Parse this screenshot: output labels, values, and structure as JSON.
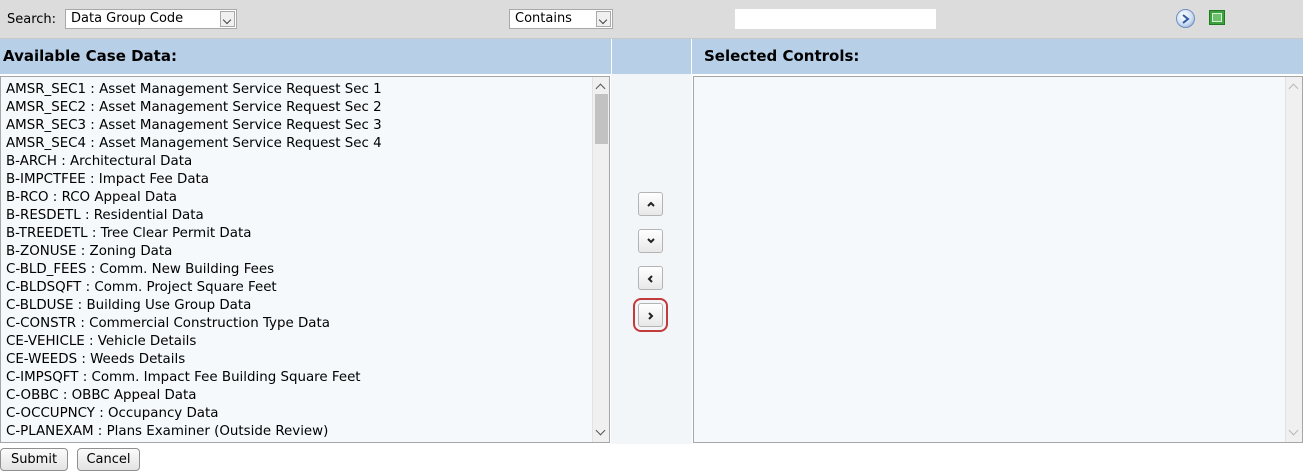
{
  "search": {
    "label": "Search:",
    "field_value": "Data Group Code",
    "operator_value": "Contains",
    "text_value": ""
  },
  "icons": {
    "go": "play-circle-icon",
    "toggle": "green-square-icon"
  },
  "headers": {
    "available": "Available Case Data:",
    "selected": "Selected Controls:"
  },
  "available_items": [
    "AMSR_SEC1 : Asset Management Service Request Sec 1",
    "AMSR_SEC2 : Asset Management Service Request Sec 2",
    "AMSR_SEC3 : Asset Management Service Request Sec 3",
    "AMSR_SEC4 : Asset Management Service Request Sec 4",
    "B-ARCH : Architectural Data",
    "B-IMPCTFEE : Impact Fee Data",
    "B-RCO : RCO Appeal Data",
    "B-RESDETL : Residential Data",
    "B-TREEDETL : Tree Clear Permit Data",
    "B-ZONUSE : Zoning Data",
    "C-BLD_FEES : Comm. New Building Fees",
    "C-BLDSQFT : Comm. Project Square Feet",
    "C-BLDUSE : Building Use Group Data",
    "C-CONSTR : Commercial Construction Type Data",
    "CE-VEHICLE : Vehicle Details",
    "CE-WEEDS : Weeds Details",
    "C-IMPSQFT : Comm. Impact Fee Building Square Feet",
    "C-OBBC : OBBC Appeal Data",
    "C-OCCUPNCY : Occupancy Data",
    "C-PLANEXAM : Plans Examiner (Outside Review)"
  ],
  "selected_items": [],
  "move_buttons": {
    "up": "chevron-up-icon",
    "down": "chevron-down-icon",
    "remove": "chevron-left-icon",
    "add": "chevron-right-icon"
  },
  "buttons": {
    "submit": "Submit",
    "cancel": "Cancel"
  },
  "colors": {
    "header_bg": "#b8cfe8",
    "search_bg": "#dcdcdc",
    "list_bg": "#f5f9fc",
    "focus_outline": "#c23a3a"
  }
}
